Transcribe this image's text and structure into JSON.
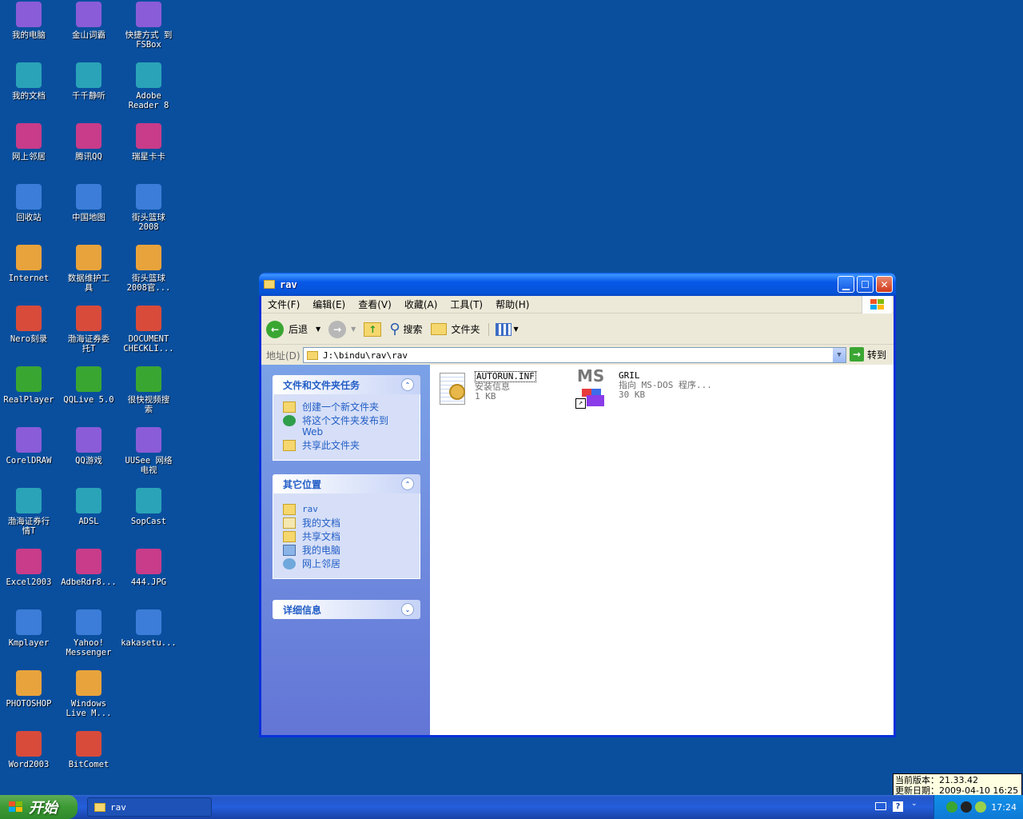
{
  "desktop": {
    "col1": [
      {
        "label": "我的电脑",
        "icon": "my-computer-icon"
      },
      {
        "label": "我的文档",
        "icon": "my-documents-icon"
      },
      {
        "label": "网上邻居",
        "icon": "network-places-icon"
      },
      {
        "label": "回收站",
        "icon": "recycle-bin-icon"
      },
      {
        "label": "Internet",
        "icon": "internet-explorer-icon"
      },
      {
        "label": "Nero刻录",
        "icon": "nero-icon"
      },
      {
        "label": "RealPlayer",
        "icon": "realplayer-icon"
      },
      {
        "label": "CorelDRAW",
        "icon": "coreldraw-icon"
      },
      {
        "label": "渤海证券行\n情T",
        "icon": "bohai-quote-icon"
      },
      {
        "label": "Excel2003",
        "icon": "excel-icon"
      },
      {
        "label": "Kmplayer",
        "icon": "kmplayer-icon"
      },
      {
        "label": "PHOTOSHOP",
        "icon": "photoshop-icon"
      },
      {
        "label": "Word2003",
        "icon": "word-icon"
      }
    ],
    "col2": [
      {
        "label": "金山词霸",
        "icon": "powerword-icon"
      },
      {
        "label": "千千静听",
        "icon": "ttplayer-icon"
      },
      {
        "label": "腾讯QQ",
        "icon": "qq-icon"
      },
      {
        "label": "中国地图",
        "icon": "china-map-icon"
      },
      {
        "label": "数据维护工\n具",
        "icon": "data-tool-icon"
      },
      {
        "label": "渤海证券委\n托T",
        "icon": "bohai-trade-icon"
      },
      {
        "label": "QQLive 5.0",
        "icon": "qqlive-icon"
      },
      {
        "label": "QQ游戏",
        "icon": "qqgame-icon"
      },
      {
        "label": "ADSL",
        "icon": "adsl-icon"
      },
      {
        "label": "AdbeRdr8...",
        "icon": "adobe-installer-icon"
      },
      {
        "label": "Yahoo!\nMessenger",
        "icon": "yahoo-messenger-icon"
      },
      {
        "label": "Windows\nLive M...",
        "icon": "windows-live-messenger-icon"
      },
      {
        "label": "BitComet",
        "icon": "bitcomet-icon"
      }
    ],
    "col3": [
      {
        "label": "快捷方式 到\nFSBox",
        "icon": "basketball-icon"
      },
      {
        "label": "Adobe\nReader 8",
        "icon": "adobe-reader-icon"
      },
      {
        "label": "瑞星卡卡",
        "icon": "rising-kaka-icon"
      },
      {
        "label": "街头篮球\n2008",
        "icon": "streetball-icon"
      },
      {
        "label": "街头篮球\n2008官...",
        "icon": "ie-shortcut-icon"
      },
      {
        "label": "DOCUMENT\nCHECKLI...",
        "icon": "pdf-document-icon"
      },
      {
        "label": "很快视频搜\n索",
        "icon": "video-search-icon"
      },
      {
        "label": "UUSee 网络\n电视",
        "icon": "uusee-icon"
      },
      {
        "label": "SopCast",
        "icon": "sopcast-icon"
      },
      {
        "label": "444.JPG",
        "icon": "jpg-file-icon"
      },
      {
        "label": "kakasetu...",
        "icon": "kaka-setup-icon"
      }
    ]
  },
  "window": {
    "title": "rav",
    "menu": [
      "文件(F)",
      "编辑(E)",
      "查看(V)",
      "收藏(A)",
      "工具(T)",
      "帮助(H)"
    ],
    "toolbar": {
      "back": "后退",
      "search": "搜索",
      "folders": "文件夹"
    },
    "address": {
      "label": "地址(D)",
      "value": "J:\\bindu\\rav\\rav",
      "go": "转到"
    },
    "tasks": {
      "title": "文件和文件夹任务",
      "items": [
        "创建一个新文件夹",
        "将这个文件夹发布到\nWeb",
        "共享此文件夹"
      ]
    },
    "places": {
      "title": "其它位置",
      "items": [
        "rav",
        "我的文档",
        "共享文档",
        "我的电脑",
        "网上邻居"
      ]
    },
    "details": {
      "title": "详细信息"
    },
    "files": [
      {
        "name": "AUTORUN.INF",
        "type": "安装信息",
        "size": "1 KB"
      },
      {
        "name": "GRIL",
        "type": "指向 MS-DOS 程序...",
        "size": "30 KB"
      }
    ]
  },
  "taskbar": {
    "start": "开始",
    "task": "rav",
    "time": "17:24",
    "tooltip": {
      "line1": "当前版本：21.33.42",
      "line2": "更新日期：2009-04-10 16:25"
    }
  }
}
